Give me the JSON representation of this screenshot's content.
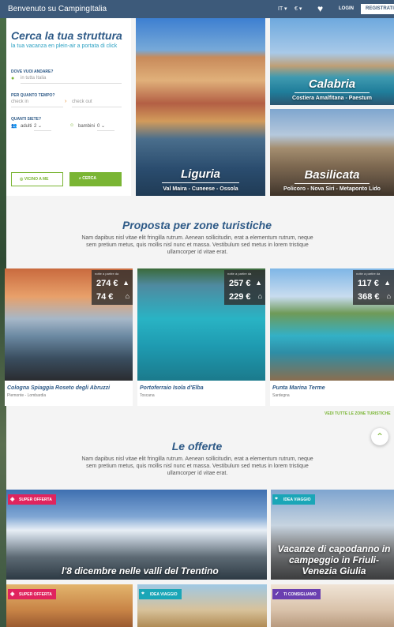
{
  "topbar": {
    "brand": "Benvenuto su CampingItalia",
    "lang": "IT ▾",
    "currency": "€ ▾",
    "login": "LOGIN",
    "register": "REGISTRATI"
  },
  "search": {
    "title": "Cerca la tua struttura",
    "subtitle": "la tua vacanza en plein-air a portata di click",
    "where_label": "DOVE VUOI ANDARE?",
    "where_placeholder": "in tutta Italia",
    "when_label": "PER QUANTO TEMPO?",
    "checkin_placeholder": "check in",
    "checkout_placeholder": "check out",
    "who_label": "QUANTI SIETE?",
    "adults_label": "adulti",
    "adults_value": "2",
    "children_label": "bambini",
    "children_value": "0",
    "near_button": "VICINO A ME",
    "search_button": "CERCA"
  },
  "regions": [
    {
      "name": "Liguria",
      "sub": "Val Maira - Cuneese - Ossola"
    },
    {
      "name": "Calabria",
      "sub": "Costiera Amalfitana - Paestum"
    },
    {
      "name": "Basilicata",
      "sub": "Policoro - Nova Siri - Metaponto Lido"
    }
  ],
  "zones_section": {
    "title": "Proposta per zone turistiche",
    "text": "Nam dapibus nisl vitae elit fringilla rutrum. Aenean sollicitudin, erat a elementum rutrum, neque sem pretium metus, quis mollis nisl nunc et massa. Vestibulum sed metus in lorem tristique ullamcorper id vitae erat.",
    "see_all": "VEDI TUTTE LE ZONE TURISTICHE"
  },
  "zones": [
    {
      "name": "Cologna Spiaggia Roseto degli Abruzzi",
      "region": "Piemonte - Lombardia",
      "note": "notte a partire da",
      "price_tent": "274 €",
      "price_home": "74 €"
    },
    {
      "name": "Portoferraio Isola d'Elba",
      "region": "Toscana",
      "note": "notte a partire da",
      "price_tent": "257 €",
      "price_home": "229 €"
    },
    {
      "name": "Punta Marina Terme",
      "region": "Sardegna",
      "note": "notte a partire da",
      "price_tent": "117 €",
      "price_home": "368 €"
    }
  ],
  "offers_section": {
    "title": "Le offerte",
    "text": "Nam dapibus nisl vitae elit fringilla rutrum. Aenean sollicitudin, erat a elementum rutrum, neque sem pretium metus, quis mollis nisl nunc et massa. Vestibulum sed metus in lorem tristique ullamcorper id vitae erat."
  },
  "offers": [
    {
      "badge": "SUPER OFFERTA",
      "title": "l'8 dicembre nelle valli del Trentino"
    },
    {
      "badge": "IDEA VIAGGIO",
      "title": "Vacanze di capodanno in campeggio in Friuli-Venezia Giulia"
    },
    {
      "badge": "SUPER OFFERTA",
      "title": ""
    },
    {
      "badge": "IDEA VIAGGIO",
      "title": ""
    },
    {
      "badge": "TI CONSIGLIAMO",
      "title": ""
    }
  ],
  "colors": {
    "primary": "#2e5a87",
    "accent": "#7ab534",
    "header": "#3d5a7a",
    "badge_red": "#e0245e",
    "badge_teal": "#1aa6b7",
    "badge_purple": "#6a3fb0"
  }
}
